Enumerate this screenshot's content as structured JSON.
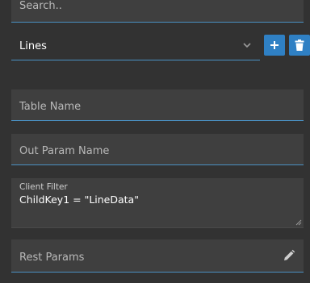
{
  "search": {
    "placeholder": "Search.."
  },
  "select": {
    "value": "Lines"
  },
  "buttons": {
    "add_icon": "plus-icon",
    "delete_icon": "trash-icon"
  },
  "fields": {
    "table_name": {
      "placeholder": "Table Name"
    },
    "out_param_name": {
      "placeholder": "Out Param Name"
    },
    "client_filter": {
      "label": "Client Filter",
      "value": "ChildKey1 = \"LineData\""
    },
    "rest_params": {
      "placeholder": "Rest Params",
      "icon": "pencil-icon"
    }
  },
  "colors": {
    "accent": "#2f80c4",
    "background": "#323232",
    "field": "#3f3f3f"
  }
}
